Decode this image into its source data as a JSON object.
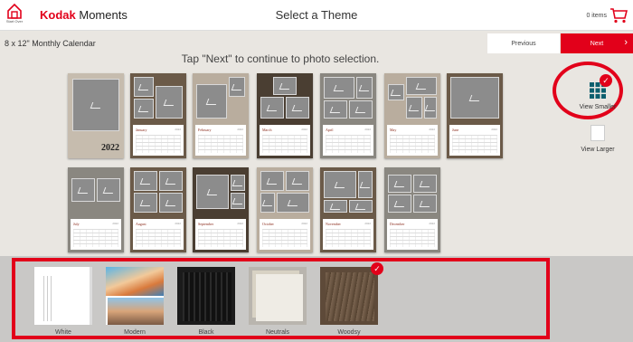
{
  "header": {
    "home_label": "Start Over",
    "brand": "Kodak",
    "brand_suffix": "Moments",
    "title": "Select a Theme",
    "cart_count": "0 items",
    "cart_icon": "cart-icon"
  },
  "subheader": {
    "product": "8 x 12\" Monthly Calendar",
    "previous": "Previous",
    "next": "Next",
    "instruction": "Tap \"Next\" to continue to photo selection."
  },
  "calendar": {
    "cover_year": "2022",
    "year_small": "2022",
    "months": [
      "January",
      "February",
      "March",
      "April",
      "May",
      "June",
      "July",
      "August",
      "September",
      "October",
      "November",
      "December"
    ]
  },
  "view": {
    "smaller": "View Smaller",
    "larger": "View Larger"
  },
  "themes": {
    "items": [
      {
        "label": "White"
      },
      {
        "label": "Modern"
      },
      {
        "label": "Black"
      },
      {
        "label": "Neutrals"
      },
      {
        "label": "Woodsy",
        "selected": true
      }
    ],
    "selected": "Woodsy"
  },
  "colors": {
    "accent": "#e2001a",
    "background": "#e9e6e1",
    "tray": "#c9c8c6"
  }
}
